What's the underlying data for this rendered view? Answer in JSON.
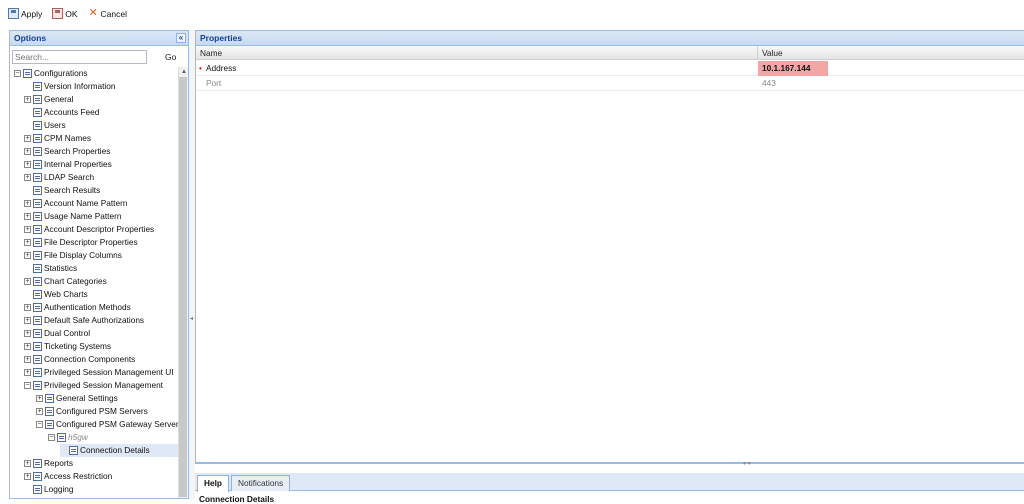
{
  "toolbar": {
    "apply": "Apply",
    "ok": "OK",
    "cancel": "Cancel"
  },
  "options": {
    "title": "Options",
    "search_placeholder": "Search...",
    "go": "Go",
    "tree": [
      {
        "label": "Configurations",
        "depth": 0,
        "exp": "minus"
      },
      {
        "label": "Version Information",
        "depth": 1,
        "exp": "none"
      },
      {
        "label": "General",
        "depth": 1,
        "exp": "plus"
      },
      {
        "label": "Accounts Feed",
        "depth": 1,
        "exp": "none"
      },
      {
        "label": "Users",
        "depth": 1,
        "exp": "none"
      },
      {
        "label": "CPM Names",
        "depth": 1,
        "exp": "plus"
      },
      {
        "label": "Search Properties",
        "depth": 1,
        "exp": "plus"
      },
      {
        "label": "Internal Properties",
        "depth": 1,
        "exp": "plus"
      },
      {
        "label": "LDAP Search",
        "depth": 1,
        "exp": "plus"
      },
      {
        "label": "Search Results",
        "depth": 1,
        "exp": "none"
      },
      {
        "label": "Account Name Pattern",
        "depth": 1,
        "exp": "plus"
      },
      {
        "label": "Usage Name Pattern",
        "depth": 1,
        "exp": "plus"
      },
      {
        "label": "Account Descriptor Properties",
        "depth": 1,
        "exp": "plus"
      },
      {
        "label": "File Descriptor Properties",
        "depth": 1,
        "exp": "plus"
      },
      {
        "label": "File Display Columns",
        "depth": 1,
        "exp": "plus"
      },
      {
        "label": "Statistics",
        "depth": 1,
        "exp": "none"
      },
      {
        "label": "Chart Categories",
        "depth": 1,
        "exp": "plus"
      },
      {
        "label": "Web Charts",
        "depth": 1,
        "exp": "none"
      },
      {
        "label": "Authentication Methods",
        "depth": 1,
        "exp": "plus"
      },
      {
        "label": "Default Safe Authorizations",
        "depth": 1,
        "exp": "plus"
      },
      {
        "label": "Dual Control",
        "depth": 1,
        "exp": "plus"
      },
      {
        "label": "Ticketing Systems",
        "depth": 1,
        "exp": "plus"
      },
      {
        "label": "Connection Components",
        "depth": 1,
        "exp": "plus"
      },
      {
        "label": "Privileged Session Management UI",
        "depth": 1,
        "exp": "plus"
      },
      {
        "label": "Privileged Session Management",
        "depth": 1,
        "exp": "minus"
      },
      {
        "label": "General Settings",
        "depth": 2,
        "exp": "plus"
      },
      {
        "label": "Configured PSM Servers",
        "depth": 2,
        "exp": "plus"
      },
      {
        "label": "Configured PSM Gateway Servers",
        "depth": 2,
        "exp": "minus"
      },
      {
        "label": "h5gw",
        "depth": 3,
        "exp": "minus",
        "muted": true
      },
      {
        "label": "Connection Details",
        "depth": 4,
        "exp": "none",
        "selected": true
      },
      {
        "label": "Reports",
        "depth": 1,
        "exp": "plus"
      },
      {
        "label": "Access Restriction",
        "depth": 1,
        "exp": "plus"
      },
      {
        "label": "Logging",
        "depth": 1,
        "exp": "none"
      }
    ]
  },
  "properties": {
    "title": "Properties",
    "col_name": "Name",
    "col_value": "Value",
    "rows": [
      {
        "name": "Address",
        "value": "10.1.167.144",
        "required": true
      },
      {
        "name": "Port",
        "value": "443",
        "required": false
      }
    ]
  },
  "tabs": {
    "help": "Help",
    "notifications": "Notifications"
  },
  "help_body": "Connection Details",
  "colors": {
    "accent": "#99bbe8",
    "selected": "#dfe8f6",
    "error_highlight": "#f4a6a6"
  }
}
